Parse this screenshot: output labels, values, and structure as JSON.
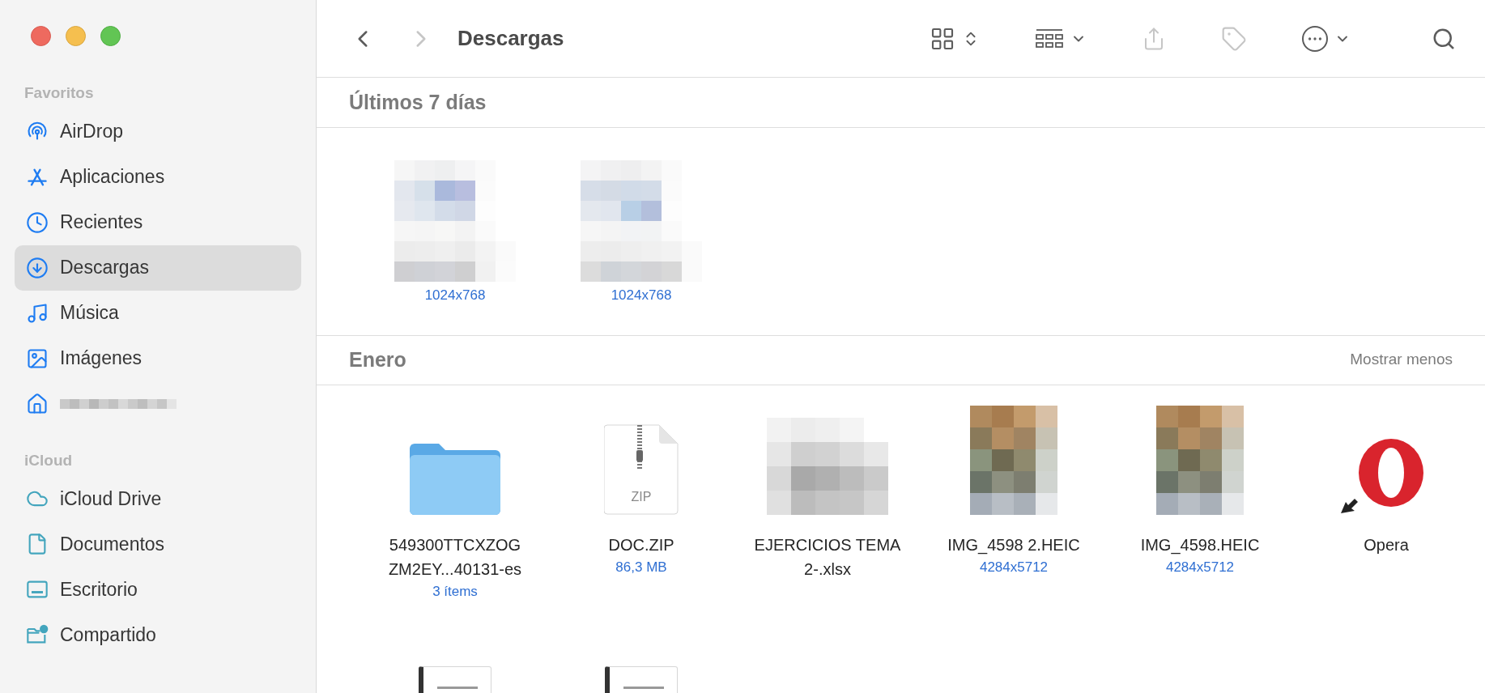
{
  "sidebar": {
    "sections": [
      {
        "title": "Favoritos",
        "items": [
          {
            "label": "AirDrop",
            "selected": false
          },
          {
            "label": "Aplicaciones",
            "selected": false
          },
          {
            "label": "Recientes",
            "selected": false
          },
          {
            "label": "Descargas",
            "selected": true
          },
          {
            "label": "Música",
            "selected": false
          },
          {
            "label": "Imágenes",
            "selected": false
          },
          {
            "kind": "blurred",
            "selected": false
          }
        ]
      },
      {
        "title": "iCloud",
        "items": [
          {
            "label": "iCloud Drive",
            "selected": false
          },
          {
            "label": "Documentos",
            "selected": false
          },
          {
            "label": "Escritorio",
            "selected": false
          },
          {
            "label": "Compartido",
            "selected": false
          }
        ]
      }
    ]
  },
  "toolbar": {
    "title": "Descargas",
    "buttons": [
      {
        "kind": "back",
        "disabled": false
      },
      {
        "kind": "forward",
        "disabled": true
      },
      {
        "kind": "view",
        "disabled": false
      },
      {
        "kind": "group",
        "disabled": false
      },
      {
        "kind": "share",
        "disabled": true
      },
      {
        "kind": "tag",
        "disabled": true
      },
      {
        "kind": "more",
        "disabled": false
      },
      {
        "kind": "search",
        "disabled": false
      }
    ]
  },
  "groups": [
    {
      "title": "Últimos 7 días",
      "files": [
        {
          "kind": "picture",
          "detail": "1024x768"
        },
        {
          "kind": "picture",
          "detail": "1024x768"
        }
      ]
    },
    {
      "title": "Enero",
      "action": "Mostrar menos",
      "files": [
        {
          "kind": "folder",
          "name": "549300TTCXZOG ZM2EY...40131-es",
          "detail": "3 ítems"
        },
        {
          "kind": "zip",
          "name": "DOC.ZIP",
          "detail": "86,3 MB",
          "badge": "ZIP"
        },
        {
          "kind": "picture",
          "name": "EJERCICIOS TEMA 2-.xlsx"
        },
        {
          "name": "IMG_4598 2.HEIC",
          "detail": "4284x5712"
        },
        {
          "name": "IMG_4598.HEIC",
          "detail": "4284x5712"
        },
        {
          "kind": "app",
          "name": "Opera"
        },
        {
          "kind": "document"
        },
        {
          "kind": "document"
        }
      ]
    }
  ]
}
